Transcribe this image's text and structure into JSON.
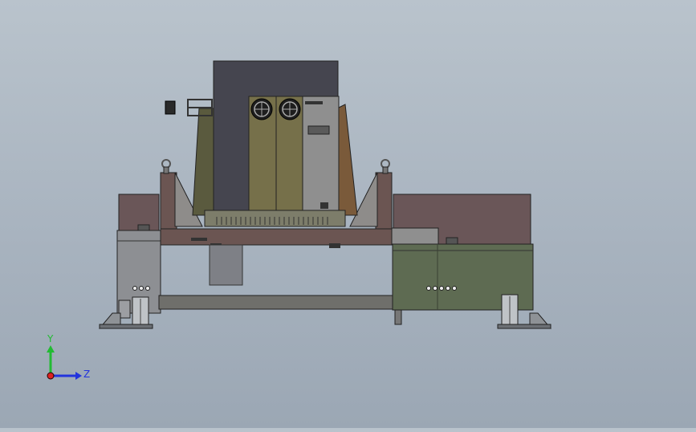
{
  "viewport": {
    "background_top": "#b9c3cc",
    "background_bottom": "#9ba7b4"
  },
  "triad": {
    "y_label": "Y",
    "z_label": "Z",
    "y_color": "#22bb33",
    "z_color": "#2233dd",
    "x_color": "#dd2222"
  },
  "model": {
    "frame_color": "#6b5552",
    "cabinet_green": "#5e6b52",
    "panel_dark": "#45454f",
    "plate_gray": "#8a8a8a",
    "bracket_brown": "#7a5a3a"
  }
}
